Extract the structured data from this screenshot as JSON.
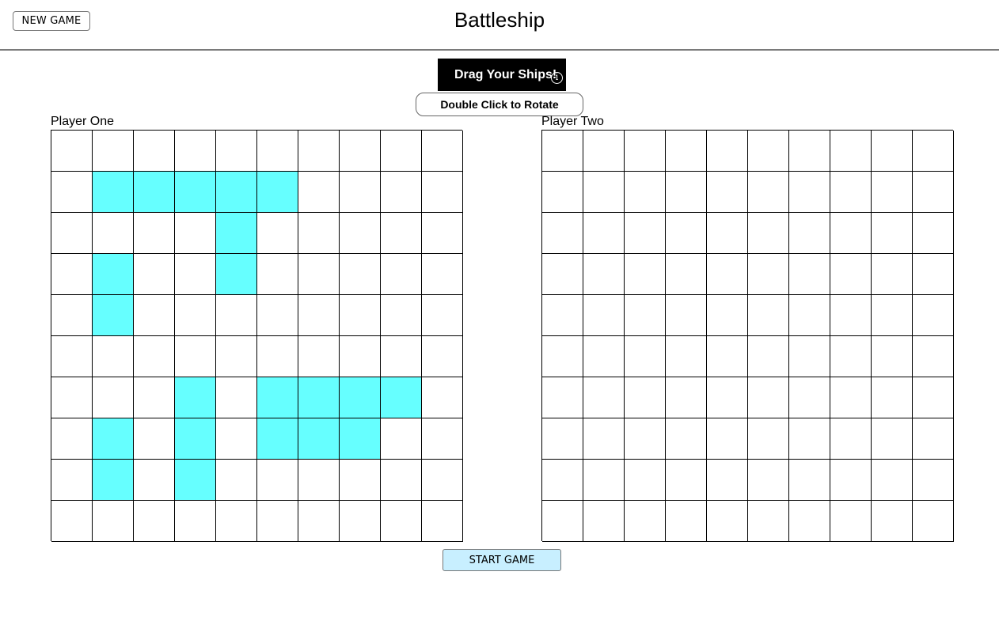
{
  "header": {
    "new_game_label": "NEW GAME",
    "title": "Battleship"
  },
  "controls": {
    "drag_label": "Drag Your Ships!",
    "info_glyph": "i",
    "rotate_label": "Double Click to Rotate",
    "start_label": "START GAME"
  },
  "colors": {
    "ship": "#66ffff",
    "start_button": "#c8efff"
  },
  "boards": {
    "rows": 10,
    "cols": 10,
    "player_one": {
      "label": "Player One",
      "ship_cells": [
        [
          1,
          1
        ],
        [
          1,
          2
        ],
        [
          1,
          3
        ],
        [
          1,
          4
        ],
        [
          1,
          5
        ],
        [
          2,
          4
        ],
        [
          3,
          4
        ],
        [
          3,
          1
        ],
        [
          4,
          1
        ],
        [
          6,
          3
        ],
        [
          7,
          3
        ],
        [
          8,
          3
        ],
        [
          6,
          5
        ],
        [
          6,
          6
        ],
        [
          6,
          7
        ],
        [
          6,
          8
        ],
        [
          7,
          5
        ],
        [
          7,
          6
        ],
        [
          7,
          7
        ],
        [
          7,
          1
        ],
        [
          8,
          1
        ]
      ]
    },
    "player_two": {
      "label": "Player Two",
      "ship_cells": []
    }
  }
}
